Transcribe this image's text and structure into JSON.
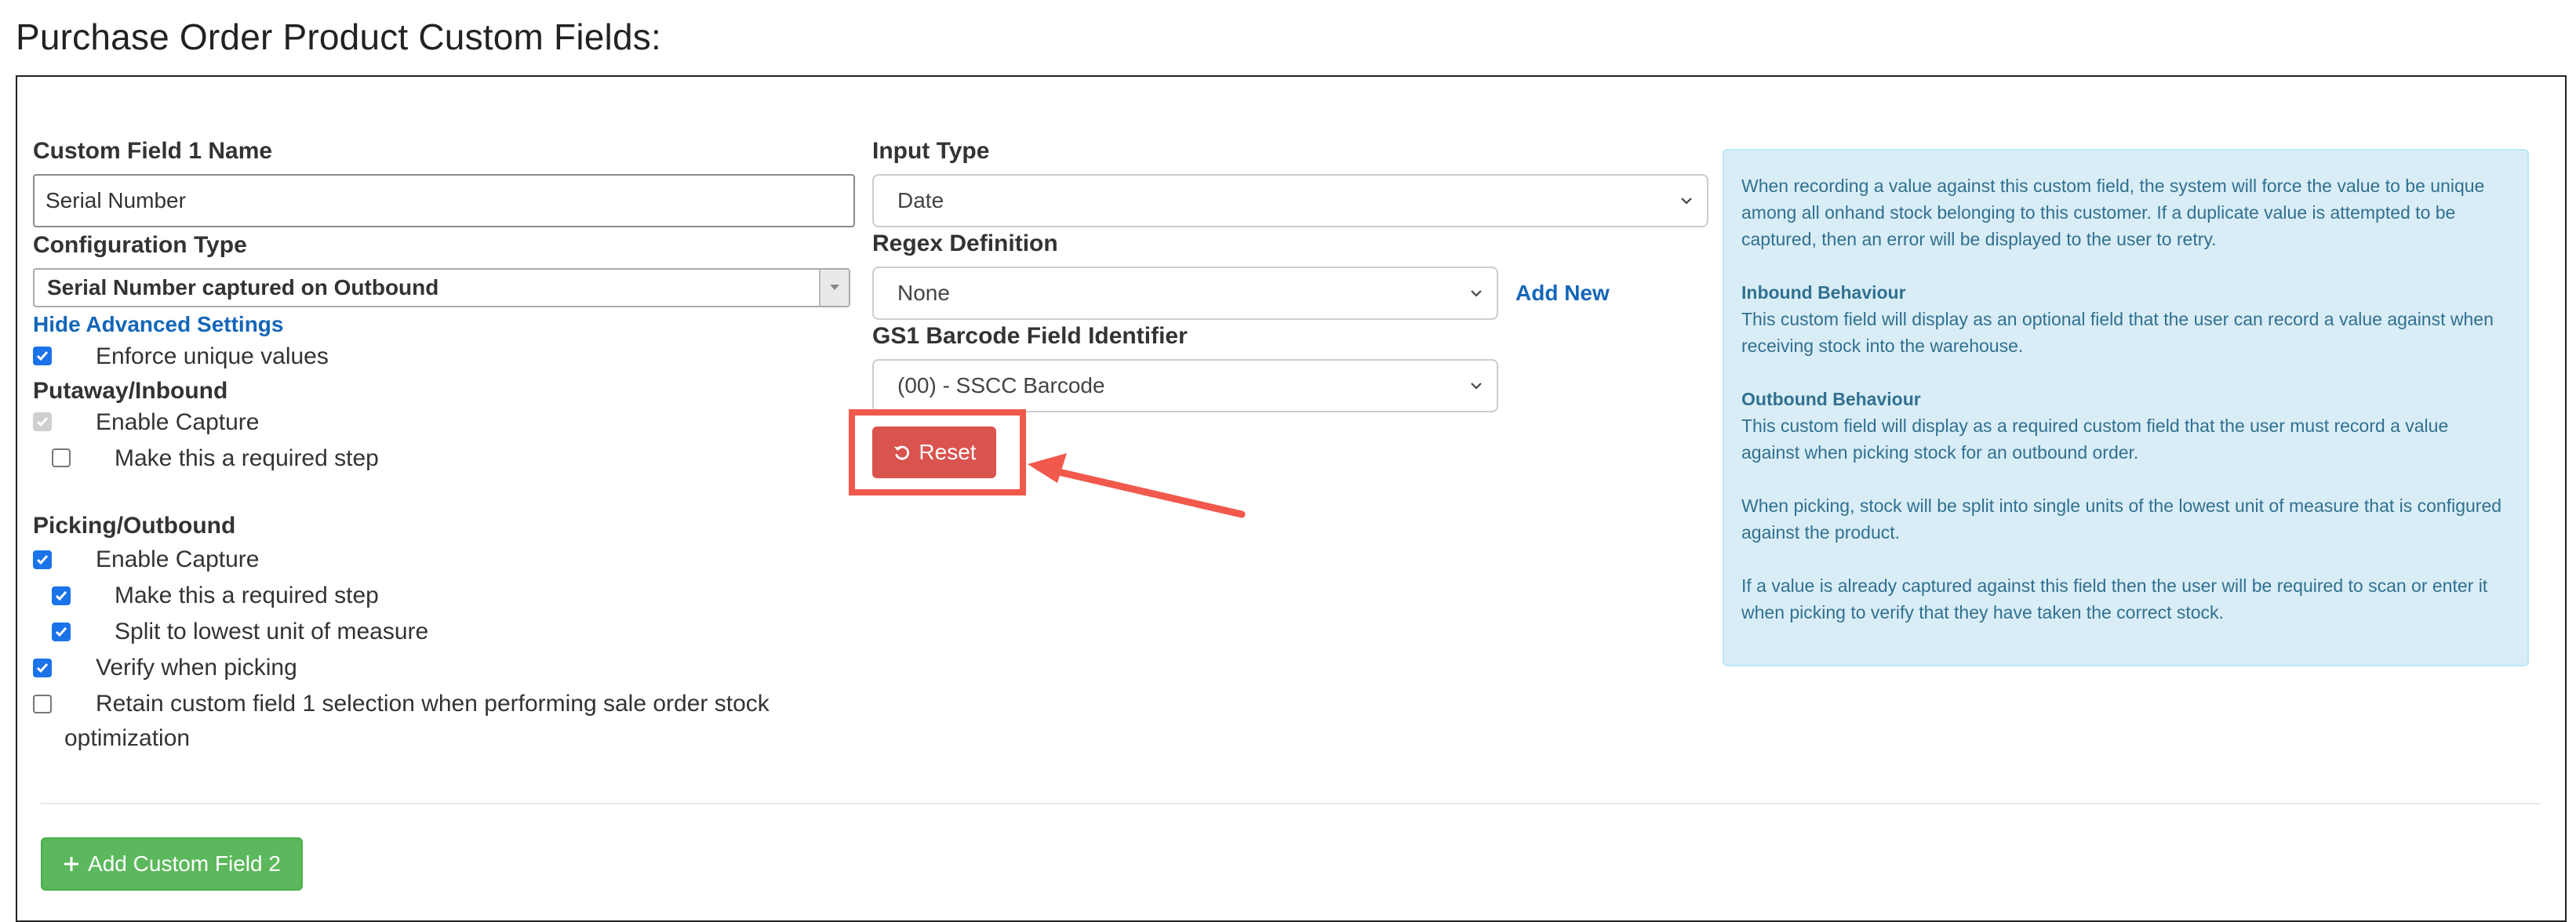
{
  "page_title": "Purchase Order Product Custom Fields:",
  "field": {
    "name_label": "Custom Field 1 Name",
    "name_value": "Serial Number",
    "config_type_label": "Configuration Type",
    "config_type_value": "Serial Number captured on Outbound",
    "advanced_link": "Hide Advanced Settings",
    "enforce_unique": {
      "label": "Enforce unique values",
      "checked": true
    },
    "putaway_heading": "Putaway/Inbound",
    "putaway_enable_capture": {
      "label": "Enable Capture",
      "checked": true,
      "disabled": true
    },
    "putaway_required_step": {
      "label": "Make this a required step",
      "checked": false
    },
    "picking_heading": "Picking/Outbound",
    "picking_enable_capture": {
      "label": "Enable Capture",
      "checked": true
    },
    "picking_required_step": {
      "label": "Make this a required step",
      "checked": true
    },
    "split_lowest_uom": {
      "label": "Split to lowest unit of measure",
      "checked": true
    },
    "verify_picking": {
      "label": "Verify when picking",
      "checked": true
    },
    "retain_selection": {
      "label_line1": "Retain custom field 1 selection when performing sale order stock",
      "label_line2": "optimization",
      "checked": false
    }
  },
  "input_type": {
    "label": "Input Type",
    "value": "Date"
  },
  "regex": {
    "label": "Regex Definition",
    "value": "None",
    "add_new": "Add New"
  },
  "gs1": {
    "label": "GS1 Barcode Field Identifier",
    "value": "(00) - SSCC Barcode"
  },
  "reset_button": {
    "label": "Reset",
    "icon": "undo-icon"
  },
  "info": {
    "intro": "When recording a value against this custom field, the system will force the value to be unique among all onhand stock belonging to this customer. If a duplicate value is attempted to be captured, then an error will be displayed to the user to retry.",
    "inbound_heading": "Inbound Behaviour",
    "inbound_text": "This custom field will display as an optional field that the user can record a value against when receiving stock into the warehouse.",
    "outbound_heading": "Outbound Behaviour",
    "outbound_text": "This custom field will display as a required custom field that the user must record a value against when picking stock for an outbound order.",
    "picking_note": "When picking, stock will be split into single units of the lowest unit of measure that is configured against the product.",
    "verify_note": "If a value is already captured against this field then the user will be required to scan or enter it when picking to verify that they have taken the correct stock."
  },
  "add_field_button": {
    "label": "Add Custom Field 2",
    "icon": "plus-icon"
  },
  "colors": {
    "highlight": "#f0594c",
    "reset": "#d9534f",
    "add": "#5cb85c",
    "info_bg": "#d9edf7",
    "link": "#1466b8"
  }
}
